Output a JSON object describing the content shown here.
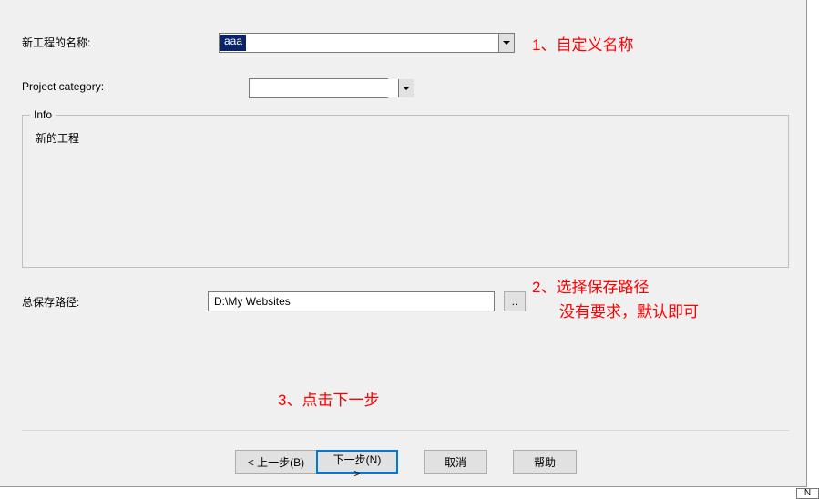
{
  "labels": {
    "project_name": "新工程的名称:",
    "project_category": "Project category:",
    "info_legend": "Info",
    "info_text": "新的工程",
    "save_path": "总保存路径:"
  },
  "fields": {
    "name_value": "aaa",
    "category_value": "",
    "path_value": "D:\\My Websites",
    "browse_label": ".."
  },
  "buttons": {
    "back": "< 上一步(B)",
    "next": "下一步(N) >",
    "cancel": "取消",
    "help": "帮助"
  },
  "annotations": {
    "a1": "1、自定义名称",
    "a2_line1": "2、选择保存路径",
    "a2_line2": "没有要求，默认即可",
    "a3": "3、点击下一步"
  },
  "corner": "N"
}
